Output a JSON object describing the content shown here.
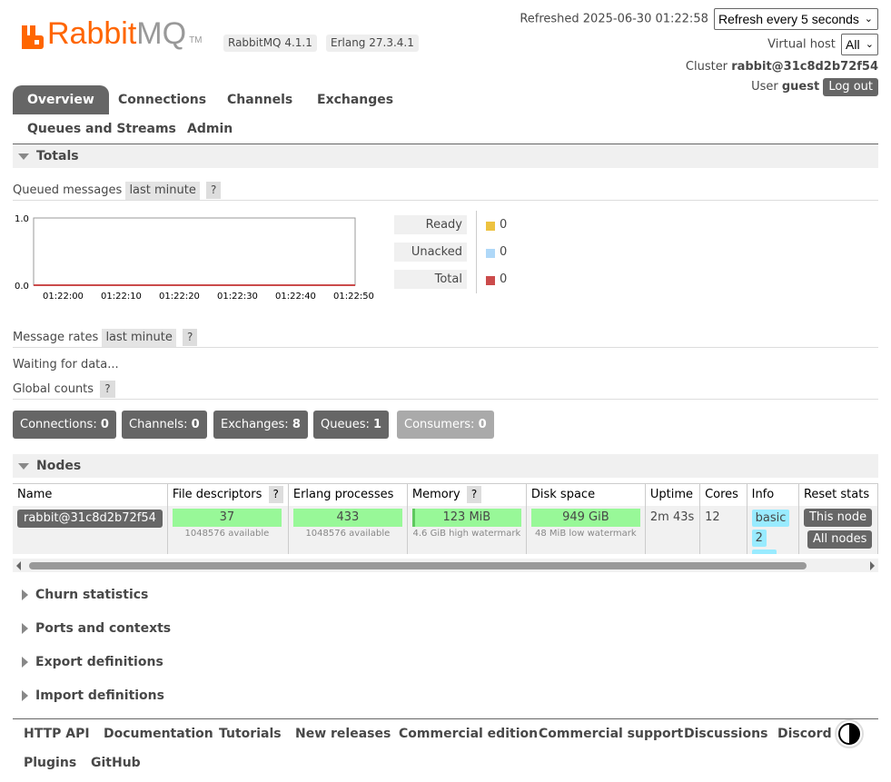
{
  "brand": {
    "name_part1": "Rabbit",
    "name_part2": "MQ",
    "tm": "TM"
  },
  "versions": {
    "rabbitmq": "RabbitMQ 4.1.1",
    "erlang": "Erlang 27.3.4.1"
  },
  "header": {
    "refreshed": "Refreshed 2025-06-30 01:22:58",
    "refresh_select": "Refresh every 5 seconds",
    "vhost_label": "Virtual host",
    "vhost_value": "All",
    "cluster_label": "Cluster",
    "cluster_value": "rabbit@31c8d2b72f54",
    "user_label": "User",
    "user_value": "guest",
    "logout": "Log out"
  },
  "tabs": [
    {
      "label": "Overview",
      "active": true
    },
    {
      "label": "Connections"
    },
    {
      "label": "Channels"
    },
    {
      "label": "Exchanges"
    },
    {
      "label": "Queues and Streams"
    },
    {
      "label": "Admin"
    }
  ],
  "totals": {
    "title": "Totals",
    "queued_label": "Queued messages",
    "period": "last minute",
    "help": "?",
    "rates_label": "Message rates",
    "waiting": "Waiting for data...",
    "global_label": "Global counts"
  },
  "legend": [
    {
      "label": "Ready",
      "value": "0",
      "color": "#edc240"
    },
    {
      "label": "Unacked",
      "value": "0",
      "color": "#afd8f8"
    },
    {
      "label": "Total",
      "value": "0",
      "color": "#cb4b4b"
    }
  ],
  "chart_data": {
    "type": "line",
    "x": [
      "01:22:00",
      "01:22:10",
      "01:22:20",
      "01:22:30",
      "01:22:40",
      "01:22:50"
    ],
    "ylim": [
      0.0,
      1.0
    ],
    "y_ticks": [
      "1.0",
      "0.0"
    ],
    "series": [
      {
        "name": "Ready",
        "values": [
          0,
          0,
          0,
          0,
          0,
          0
        ],
        "color": "#edc240"
      },
      {
        "name": "Unacked",
        "values": [
          0,
          0,
          0,
          0,
          0,
          0
        ],
        "color": "#afd8f8"
      },
      {
        "name": "Total",
        "values": [
          0,
          0,
          0,
          0,
          0,
          0
        ],
        "color": "#cb4b4b"
      }
    ]
  },
  "counts": [
    {
      "label": "Connections:",
      "value": "0"
    },
    {
      "label": "Channels:",
      "value": "0"
    },
    {
      "label": "Exchanges:",
      "value": "8"
    },
    {
      "label": "Queues:",
      "value": "1"
    },
    {
      "label": "Consumers:",
      "value": "0",
      "disabled": true
    }
  ],
  "nodes": {
    "title": "Nodes",
    "columns": [
      "Name",
      "File descriptors",
      "Erlang processes",
      "Memory",
      "Disk space",
      "Uptime",
      "Cores",
      "Info",
      "Reset stats"
    ],
    "help": "?",
    "row": {
      "name": "rabbit@31c8d2b72f54",
      "fd": "37",
      "fd_sub": "1048576 available",
      "erl": "433",
      "erl_sub": "1048576 available",
      "mem": "123 MiB",
      "mem_sub": "4.6 GiB high watermark",
      "disk": "949 GiB",
      "disk_sub": "48 MiB low watermark",
      "uptime": "2m 43s",
      "cores": "12",
      "info": [
        "basic",
        "2",
        "rss"
      ],
      "reset_this": "This node",
      "reset_all": "All nodes"
    }
  },
  "collapsed_sections": [
    "Churn statistics",
    "Ports and contexts",
    "Export definitions",
    "Import definitions"
  ],
  "footer": {
    "links": [
      "HTTP API",
      "Documentation",
      "Tutorials",
      "New releases",
      "Commercial edition",
      "Commercial support",
      "Discussions",
      "Discord"
    ],
    "links2": [
      "Plugins",
      "GitHub"
    ]
  }
}
